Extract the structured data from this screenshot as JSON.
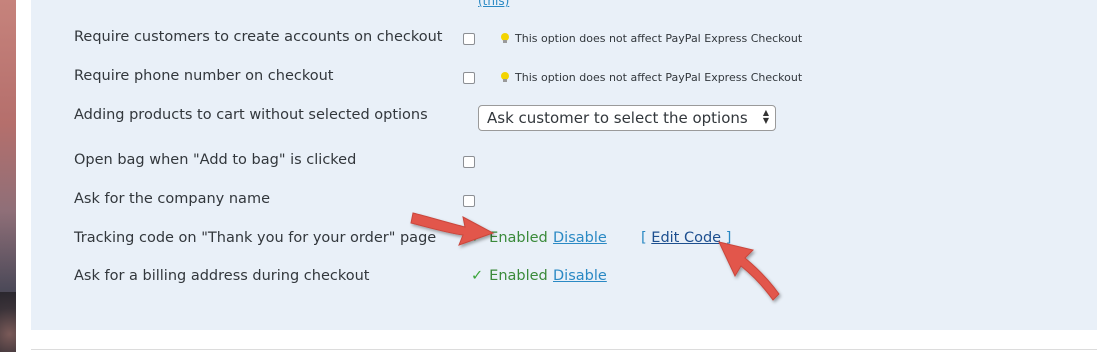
{
  "top_link": "(this)",
  "settings": [
    {
      "label": "Require customers to create accounts on checkout",
      "hint": "This option does not affect PayPal Express Checkout"
    },
    {
      "label": "Require phone number on checkout",
      "hint": "This option does not affect PayPal Express Checkout"
    },
    {
      "label": "Adding products to cart without selected options",
      "select_value": "Ask customer to select the options"
    },
    {
      "label": "Open bag when \"Add to bag\" is clicked"
    },
    {
      "label": "Ask for the company name"
    },
    {
      "label": "Tracking code on \"Thank you for your order\" page",
      "status": "Enabled",
      "action": "Disable",
      "edit_open": "[",
      "edit_label": "Edit Code",
      "edit_close": "]"
    },
    {
      "label": "Ask for a billing address during checkout",
      "status": "Enabled",
      "action": "Disable"
    }
  ],
  "colors": {
    "panel_bg": "#e9f0f8",
    "link": "#2a89c4",
    "enabled_green": "#3a8a3a",
    "annotation_arrow": "#e2574c"
  },
  "icons": {
    "hint": "lightbulb-icon",
    "status": "checkmark-icon",
    "annotation": "red-arrow-icon"
  }
}
